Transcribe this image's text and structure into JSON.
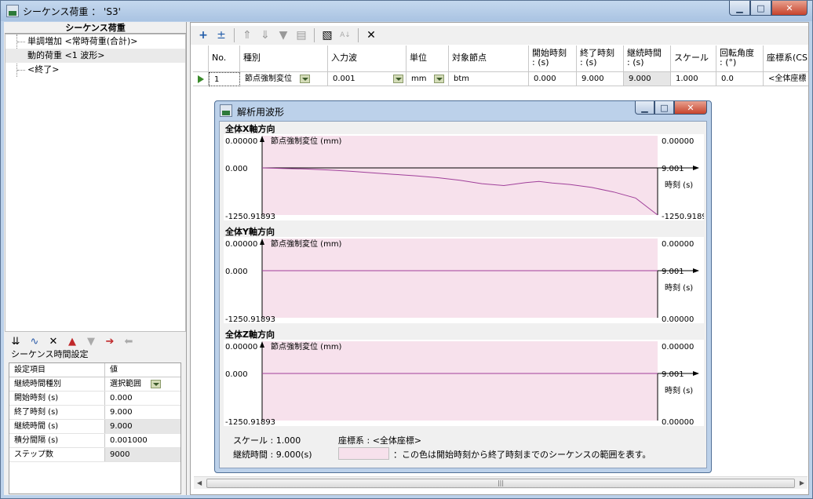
{
  "window": {
    "title": "シーケンス荷重 ： 'S3'",
    "minimize": "▁",
    "maximize": "□",
    "close": "✕"
  },
  "left": {
    "tree_header": "シーケンス荷重",
    "tree_items": [
      "単調増加 <常時荷重(合計)>",
      "動的荷重 <1 波形>",
      "<終了>"
    ],
    "section_title": "シーケンス時間設定",
    "table_headers": [
      "設定項目",
      "値"
    ],
    "table_rows": [
      {
        "k": "継続時間種別",
        "v": "選択範囲"
      },
      {
        "k": "開始時刻 (s)",
        "v": "0.000"
      },
      {
        "k": "終了時刻 (s)",
        "v": "9.000"
      },
      {
        "k": "継続時間 (s)",
        "v": "9.000"
      },
      {
        "k": "積分間隔 (s)",
        "v": "0.001000"
      },
      {
        "k": "ステップ数",
        "v": "9000"
      }
    ],
    "toolbar_icons": [
      "expand-icon",
      "wave-icon",
      "delete-icon",
      "up-red-icon",
      "down-grey-icon",
      "right-arrow-icon",
      "left-arrow-icon"
    ]
  },
  "grid": {
    "headers": [
      "No.",
      "種別",
      "入力波",
      "単位",
      "対象節点",
      "開始時刻\n: (s)",
      "終了時刻\n: (s)",
      "継続時間\n: (s)",
      "スケール",
      "回転角度\n: (°)",
      "座標系(CS"
    ],
    "row": [
      "1",
      "節点強制変位",
      "0.001",
      "mm",
      "btm",
      "0.000",
      "9.000",
      "9.000",
      "1.000",
      "0.0",
      "<全体座標"
    ]
  },
  "dialog": {
    "title": "解析用波形",
    "panels": [
      {
        "title": "全体X軸方向",
        "ylabel": "節点強制変位 (mm)",
        "ytop": "0.00000",
        "yzero": "0.000",
        "ybottom": "-1250.91893",
        "rtop": "0.00000",
        "rtime": "9.001",
        "rbottom": "-1250.9189",
        "xlabel": "時刻 (s)"
      },
      {
        "title": "全体Y軸方向",
        "ylabel": "節点強制変位 (mm)",
        "ytop": "0.00000",
        "yzero": "0.000",
        "ybottom": "-1250.91893",
        "rtop": "0.00000",
        "rtime": "9.001",
        "rbottom": "0.00000",
        "xlabel": "時刻 (s)"
      },
      {
        "title": "全体Z軸方向",
        "ylabel": "節点強制変位 (mm)",
        "ytop": "0.00000",
        "yzero": "0.000",
        "ybottom": "-1250.91893",
        "rtop": "0.00000",
        "rtime": "9.001",
        "rbottom": "0.00000",
        "xlabel": "時刻 (s)"
      }
    ],
    "footer": {
      "scale": "スケール : 1.000",
      "duration": "継続時間 : 9.000(s)",
      "coord": "座標系 : <全体座標>",
      "legend": "：この色は開始時刻から終了時刻までのシーケンスの範囲を表す。"
    }
  },
  "colors": {
    "sequence_range": "#f7e1ec",
    "wave_line": "#a0409a"
  },
  "chart_data": [
    {
      "type": "line",
      "title": "全体X軸方向",
      "ylabel": "節点強制変位 (mm)",
      "xlabel": "時刻 (s)",
      "xlim": [
        0,
        9.001
      ],
      "ylim": [
        -1250.91893,
        0.0
      ],
      "x": [
        0.0,
        0.5,
        1.0,
        1.5,
        2.0,
        2.5,
        3.0,
        3.5,
        4.0,
        4.5,
        5.0,
        5.5,
        6.0,
        6.3,
        6.6,
        7.0,
        7.5,
        8.0,
        8.5,
        9.0
      ],
      "y": [
        0,
        -15,
        -30,
        -55,
        -90,
        -130,
        -170,
        -210,
        -260,
        -330,
        -420,
        -470,
        -390,
        -360,
        -400,
        -440,
        -520,
        -640,
        -800,
        -1250
      ]
    },
    {
      "type": "line",
      "title": "全体Y軸方向",
      "ylabel": "節点強制変位 (mm)",
      "xlabel": "時刻 (s)",
      "xlim": [
        0,
        9.001
      ],
      "x": [
        0,
        9.0
      ],
      "y": [
        0,
        0
      ]
    },
    {
      "type": "line",
      "title": "全体Z軸方向",
      "ylabel": "節点強制変位 (mm)",
      "xlabel": "時刻 (s)",
      "xlim": [
        0,
        9.001
      ],
      "x": [
        0,
        9.0
      ],
      "y": [
        0,
        0
      ]
    }
  ]
}
